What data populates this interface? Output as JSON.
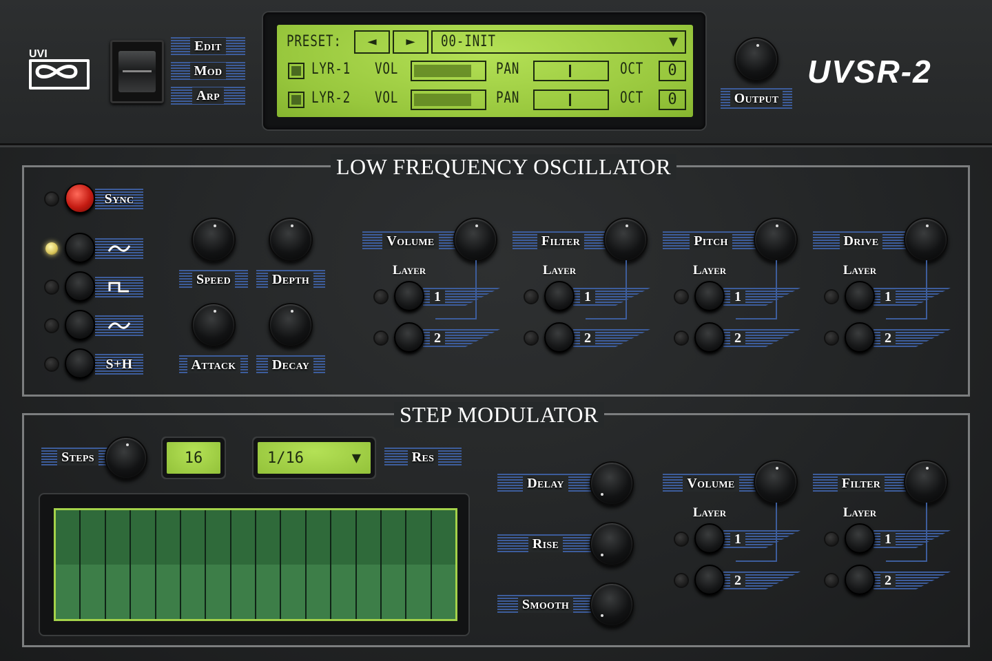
{
  "brand": {
    "logo_text": "UVI",
    "product_name": "UVSR-2"
  },
  "nav": {
    "edit": "Edit",
    "mod": "Mod",
    "arp": "Arp"
  },
  "display": {
    "preset_label": "PRESET:",
    "prev_glyph": "◄",
    "next_glyph": "►",
    "preset_name": "00-INIT",
    "dropdown_glyph": "▼",
    "layers": [
      {
        "name": "LYR-1",
        "vol_label": "VOL",
        "vol_level": 0.86,
        "pan_label": "PAN",
        "pan_value": 0.5,
        "oct_label": "OCT",
        "oct_value": "0"
      },
      {
        "name": "LYR-2",
        "vol_label": "VOL",
        "vol_level": 0.86,
        "pan_label": "PAN",
        "pan_value": 0.5,
        "oct_label": "OCT",
        "oct_value": "0"
      }
    ]
  },
  "output_label": "Output",
  "lfo": {
    "title": "LOW FREQUENCY OSCILLATOR",
    "sync_label": "Sync",
    "waveforms": [
      {
        "symbol": "∼",
        "active": true
      },
      {
        "symbol": "⊓",
        "active": false
      },
      {
        "symbol": "∼",
        "active": false
      },
      {
        "symbol": "S+H",
        "active": false
      }
    ],
    "knobs": {
      "speed": "Speed",
      "depth": "Depth",
      "attack": "Attack",
      "decay": "Decay"
    },
    "destinations": [
      {
        "label": "Volume",
        "layer_label": "Layer",
        "layer_1": "1",
        "layer_2": "2"
      },
      {
        "label": "Filter",
        "layer_label": "Layer",
        "layer_1": "1",
        "layer_2": "2"
      },
      {
        "label": "Pitch",
        "layer_label": "Layer",
        "layer_1": "1",
        "layer_2": "2"
      },
      {
        "label": "Drive",
        "layer_label": "Layer",
        "layer_1": "1",
        "layer_2": "2"
      }
    ]
  },
  "step_mod": {
    "title": "STEP MODULATOR",
    "steps_label": "Steps",
    "steps_value": "16",
    "res_value": "1/16",
    "res_dropdown_glyph": "▼",
    "res_label": "Res",
    "step_count": 16,
    "knobs": {
      "delay": "Delay",
      "rise": "Rise",
      "smooth": "Smooth"
    },
    "destinations": [
      {
        "label": "Volume",
        "layer_label": "Layer",
        "layer_1": "1",
        "layer_2": "2"
      },
      {
        "label": "Filter",
        "layer_label": "Layer",
        "layer_1": "1",
        "layer_2": "2"
      }
    ]
  },
  "colors": {
    "lcd_green": "#a8d84b",
    "stripe_blue": "#3d5d9c",
    "panel": "#26292a",
    "sync_red": "#c41b12"
  }
}
